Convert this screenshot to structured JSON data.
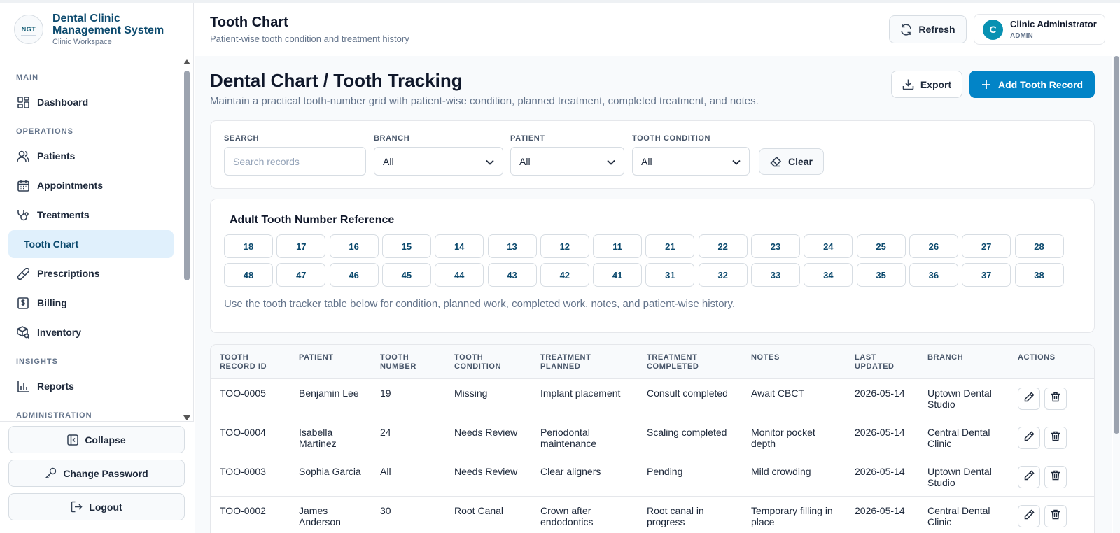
{
  "brand": {
    "logo_text": "NGT",
    "name": "Dental Clinic Management System",
    "sub": "Clinic Workspace"
  },
  "sidebar": {
    "sections": {
      "main": "MAIN",
      "operations": "OPERATIONS",
      "insights": "INSIGHTS",
      "administration": "ADMINISTRATION"
    },
    "items": {
      "dashboard": "Dashboard",
      "patients": "Patients",
      "appointments": "Appointments",
      "treatments": "Treatments",
      "tooth_chart": "Tooth Chart",
      "prescriptions": "Prescriptions",
      "billing": "Billing",
      "inventory": "Inventory",
      "reports": "Reports"
    },
    "footer": {
      "collapse": "Collapse",
      "change_password": "Change Password",
      "logout": "Logout"
    }
  },
  "header": {
    "title": "Tooth Chart",
    "subtitle": "Patient-wise tooth condition and treatment history",
    "refresh": "Refresh",
    "user": {
      "initial": "C",
      "name": "Clinic Administrator",
      "role": "ADMIN"
    }
  },
  "main": {
    "title": "Dental Chart / Tooth Tracking",
    "subtitle": "Maintain a practical tooth-number grid with patient-wise condition, planned treatment, completed treatment, and notes.",
    "export": "Export",
    "add": "Add Tooth Record"
  },
  "filters": {
    "search_label": "SEARCH",
    "search_placeholder": "Search records",
    "branch_label": "BRANCH",
    "branch_value": "All",
    "patient_label": "PATIENT",
    "patient_value": "All",
    "condition_label": "TOOTH CONDITION",
    "condition_value": "All",
    "clear": "Clear"
  },
  "teeth": {
    "title": "Adult Tooth Number Reference",
    "upper": [
      "18",
      "17",
      "16",
      "15",
      "14",
      "13",
      "12",
      "11",
      "21",
      "22",
      "23",
      "24",
      "25",
      "26",
      "27",
      "28"
    ],
    "lower": [
      "48",
      "47",
      "46",
      "45",
      "44",
      "43",
      "42",
      "41",
      "31",
      "32",
      "33",
      "34",
      "35",
      "36",
      "37",
      "38"
    ],
    "note": "Use the tooth tracker table below for condition, planned work, completed work, notes, and patient-wise history."
  },
  "table": {
    "headers": {
      "id": "TOOTH RECORD ID",
      "patient": "PATIENT",
      "number": "TOOTH NUMBER",
      "condition": "TOOTH CONDITION",
      "planned": "TREATMENT PLANNED",
      "completed": "TREATMENT COMPLETED",
      "notes": "NOTES",
      "updated": "LAST UPDATED",
      "branch": "BRANCH",
      "actions": "ACTIONS"
    },
    "rows": [
      {
        "id": "TOO-0005",
        "patient": "Benjamin Lee",
        "number": "19",
        "condition": "Missing",
        "planned": "Implant placement",
        "completed": "Consult completed",
        "notes": "Await CBCT",
        "updated": "2026-05-14",
        "branch": "Uptown Dental Studio"
      },
      {
        "id": "TOO-0004",
        "patient": "Isabella Martinez",
        "number": "24",
        "condition": "Needs Review",
        "planned": "Periodontal maintenance",
        "completed": "Scaling completed",
        "notes": "Monitor pocket depth",
        "updated": "2026-05-14",
        "branch": "Central Dental Clinic"
      },
      {
        "id": "TOO-0003",
        "patient": "Sophia Garcia",
        "number": "All",
        "condition": "Needs Review",
        "planned": "Clear aligners",
        "completed": "Pending",
        "notes": "Mild crowding",
        "updated": "2026-05-14",
        "branch": "Uptown Dental Studio"
      },
      {
        "id": "TOO-0002",
        "patient": "James Anderson",
        "number": "30",
        "condition": "Root Canal",
        "planned": "Crown after endodontics",
        "completed": "Root canal in progress",
        "notes": "Temporary filling in place",
        "updated": "2026-05-14",
        "branch": "Central Dental Clinic"
      }
    ]
  },
  "colors": {
    "accent": "#0284c7",
    "active_bg": "#e0f0fc",
    "brand_text": "#0c4a6e"
  }
}
